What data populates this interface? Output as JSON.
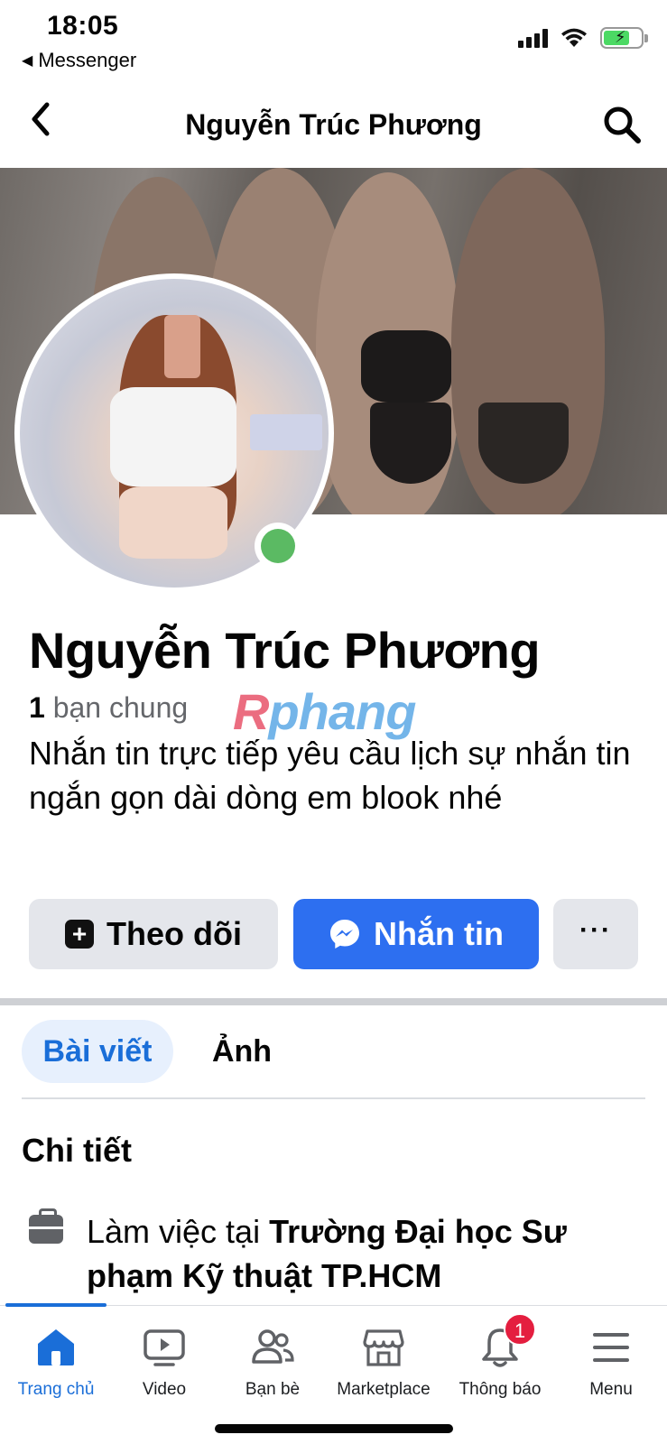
{
  "status_bar": {
    "time": "18:05",
    "back_app": "Messenger",
    "battery_color": "#4cd964"
  },
  "header": {
    "title": "Nguyễn Trúc Phương",
    "back_icon": "chevron-left-icon",
    "search_icon": "search-icon"
  },
  "profile": {
    "name": "Nguyễn Trúc Phương",
    "mutual_count": "1",
    "mutual_label": "bạn chung",
    "watermark": "Rphang",
    "bio": "Nhắn tin trực tiếp yêu cầu lịch sự nhắn tin ngắn gọn dài dòng em blook nhé",
    "online": true,
    "online_color": "#5bba63"
  },
  "actions": {
    "follow_label": "Theo dõi",
    "message_label": "Nhắn tin",
    "more_label": "···",
    "message_color": "#2d6ff0"
  },
  "tabs": [
    {
      "label": "Bài viết",
      "active": true
    },
    {
      "label": "Ảnh",
      "active": false
    }
  ],
  "details": {
    "title": "Chi tiết",
    "work_prefix": "Làm việc tại ",
    "work_place": "Trường Đại học Sư phạm Kỹ thuật TP.HCM"
  },
  "bottom_nav": {
    "items": [
      {
        "label": "Trang chủ",
        "icon": "home-icon",
        "active": true
      },
      {
        "label": "Video",
        "icon": "video-icon",
        "active": false
      },
      {
        "label": "Bạn bè",
        "icon": "friends-icon",
        "active": false
      },
      {
        "label": "Marketplace",
        "icon": "marketplace-icon",
        "active": false
      },
      {
        "label": "Thông báo",
        "icon": "bell-icon",
        "active": false,
        "badge": "1"
      },
      {
        "label": "Menu",
        "icon": "menu-icon",
        "active": false
      }
    ],
    "accent_color": "#1a6ed8"
  }
}
